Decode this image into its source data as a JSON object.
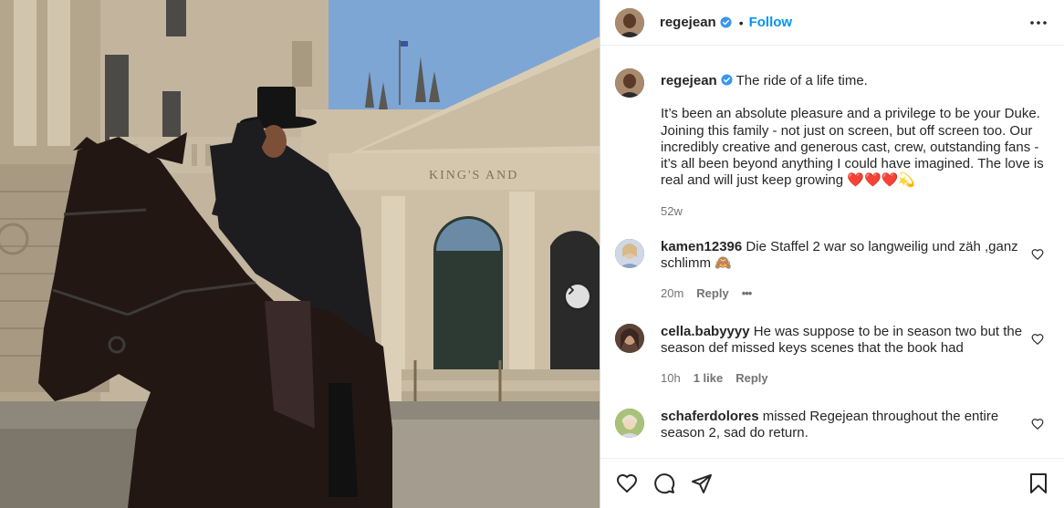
{
  "post": {
    "username": "regejean",
    "follow_label": "Follow",
    "separator": "•",
    "caption_first_line": "The ride of a life time.",
    "caption_body": "It’s been an absolute pleasure and a privilege to be your Duke. Joining this family - not just on screen, but off screen too. Our incredibly creative and generous cast, crew, outstanding fans - it’s all been beyond anything I could have imagined. The love is real and will just keep growing ❤️❤️❤️💫",
    "time_ago": "52w",
    "image_sign_text": "KING'S AND"
  },
  "comments": [
    {
      "username": "kamen12396",
      "text": "Die Staffel 2 war so langweilig und zäh ,ganz schlimm 🙈",
      "time": "20m",
      "likes": "",
      "reply_label": "Reply",
      "more": "•••"
    },
    {
      "username": "cella.babyyyy",
      "text": "He was suppose to be in season two but the season def missed keys scenes that the book had",
      "time": "10h",
      "likes": "1 like",
      "reply_label": "Reply"
    },
    {
      "username": "schaferdolores",
      "text": "missed Regejean throughout the entire season 2, sad do return."
    }
  ],
  "icons": {
    "header_more": "more-horizontal-icon",
    "verified": "verified-badge-icon",
    "like": "heart-icon",
    "comment": "comment-icon",
    "share": "share-icon",
    "save": "bookmark-icon",
    "comment_like": "heart-small-icon",
    "carousel_next": "chevron-right-icon"
  },
  "colors": {
    "accent": "#0095f6",
    "verified": "#3897f0",
    "secondary_text": "#737373"
  }
}
